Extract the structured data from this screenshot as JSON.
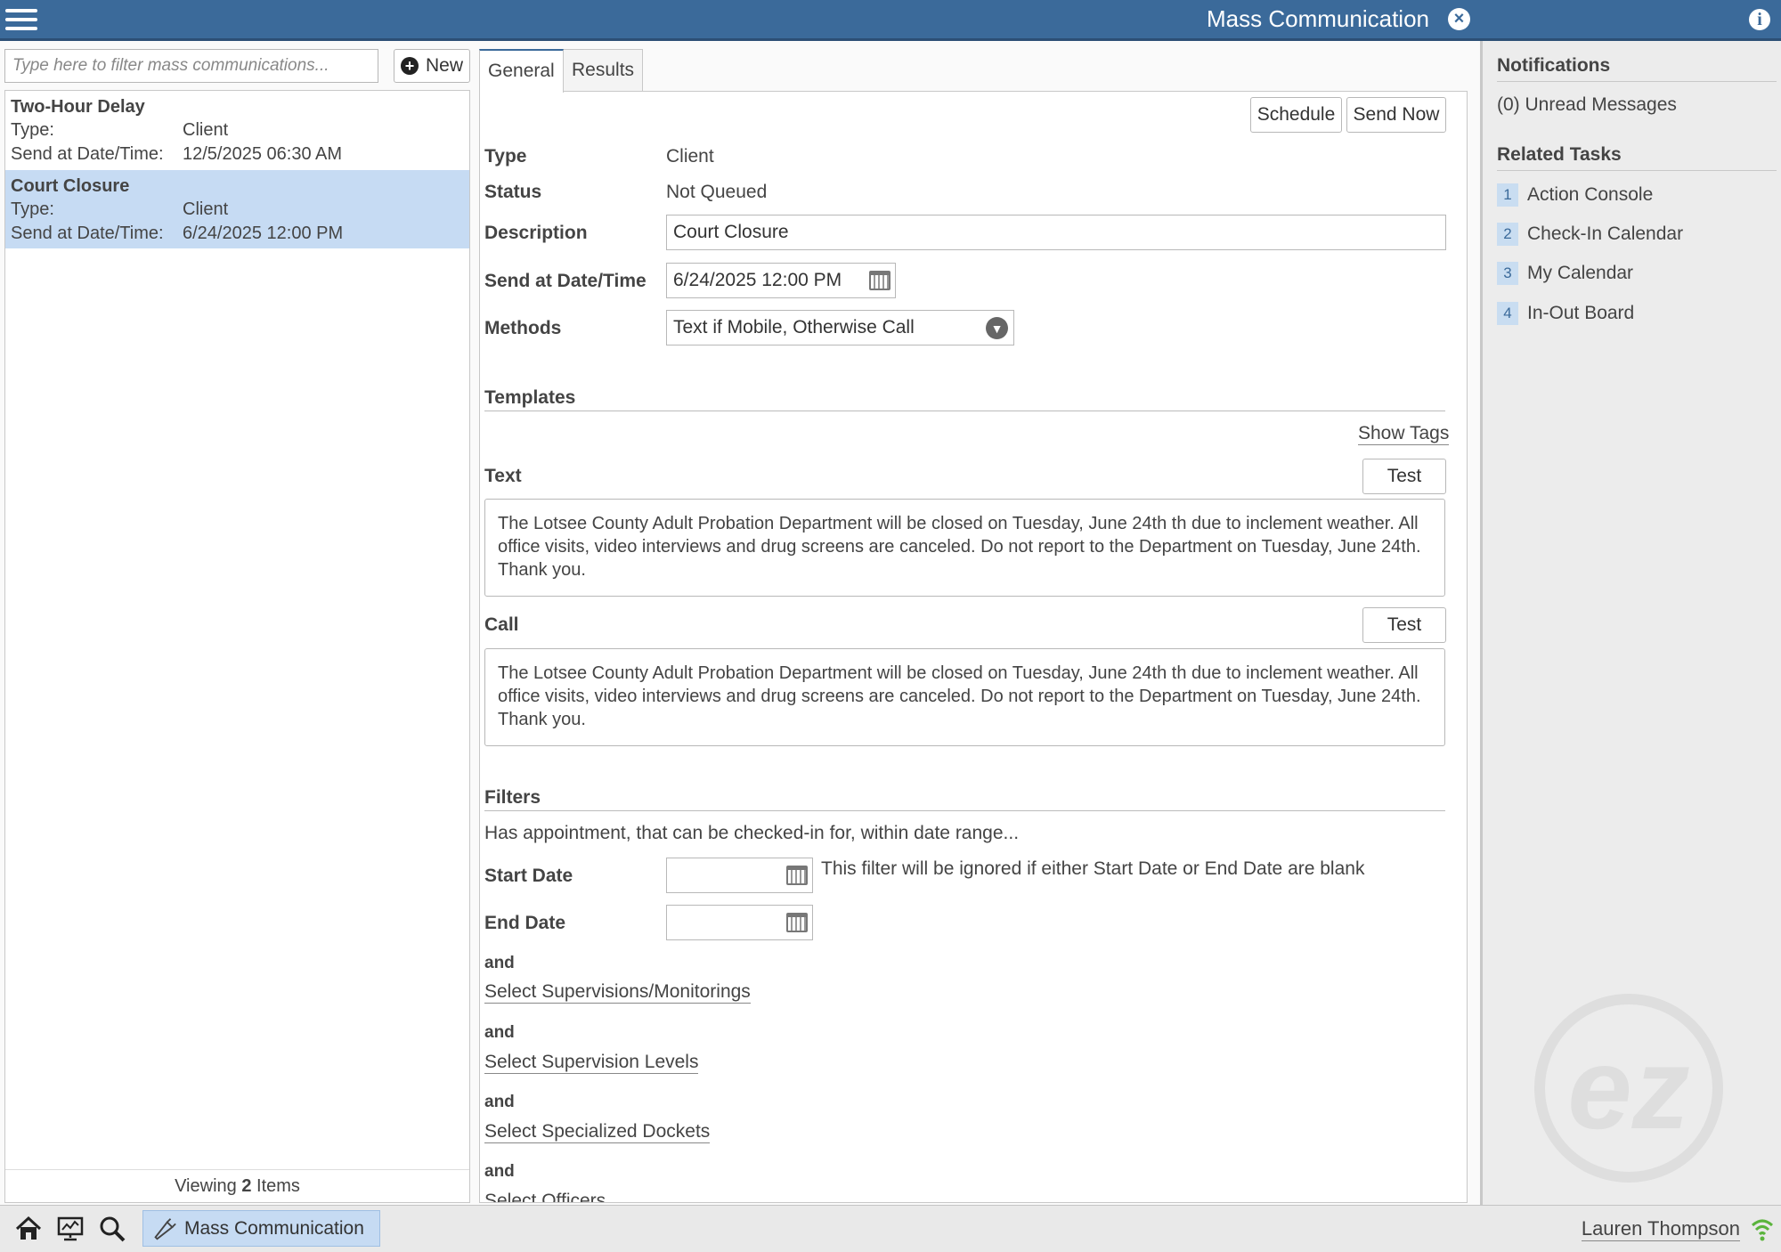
{
  "app": {
    "title": "Mass Communication"
  },
  "filter": {
    "placeholder": "Type here to filter mass communications...",
    "new_label": "New"
  },
  "list": {
    "items": [
      {
        "title": "Two-Hour Delay",
        "type_key": "Type:",
        "type_value": "Client",
        "send_key": "Send at Date/Time:",
        "send_value": "12/5/2025 06:30 AM",
        "selected": false
      },
      {
        "title": "Court Closure",
        "type_key": "Type:",
        "type_value": "Client",
        "send_key": "Send at Date/Time:",
        "send_value": "6/24/2025 12:00 PM",
        "selected": true
      }
    ],
    "footer_prefix": "Viewing",
    "footer_count": "2",
    "footer_suffix": "Items"
  },
  "tabs": [
    {
      "label": "General",
      "active": true
    },
    {
      "label": "Results",
      "active": false
    }
  ],
  "toolbar": {
    "schedule_label": "Schedule",
    "send_now_label": "Send Now"
  },
  "details": {
    "type_label": "Type",
    "type_value": "Client",
    "status_label": "Status",
    "status_value": "Not Queued",
    "description_label": "Description",
    "description_value": "Court Closure",
    "send_label": "Send at Date/Time",
    "send_value": "6/24/2025 12:00 PM",
    "methods_label": "Methods",
    "methods_value": "Text if Mobile, Otherwise Call"
  },
  "templates": {
    "heading": "Templates",
    "show_tags_label": "Show Tags",
    "text_label": "Text",
    "call_label": "Call",
    "test_label": "Test",
    "text_body": "The Lotsee County Adult Probation Department  will be closed on Tuesday, June 24th th due to inclement weather. All office visits, video interviews and drug screens are canceled. Do not report to the Department on Tuesday, June 24th. Thank you.",
    "call_body": "The Lotsee County Adult Probation Department  will be closed on Tuesday, June 24th th due to inclement weather. All office visits, video interviews and drug screens are canceled. Do not report to the Department on Tuesday, June 24th. Thank you."
  },
  "filters": {
    "heading": "Filters",
    "intro": "Has appointment, that can be checked-in for, within date range...",
    "start_label": "Start Date",
    "end_label": "End Date",
    "start_value": "",
    "end_value": "",
    "note": "This filter will be ignored if either Start Date or End Date are blank",
    "and_label": "and",
    "links": [
      "Select Supervisions/Monitorings",
      "Select Supervision Levels",
      "Select Specialized Dockets",
      "Select Officers"
    ]
  },
  "sidebar": {
    "notifications_heading": "Notifications",
    "unread": "(0) Unread Messages",
    "related_heading": "Related Tasks",
    "tasks": [
      {
        "num": "1",
        "label": "Action Console"
      },
      {
        "num": "2",
        "label": "Check-In Calendar"
      },
      {
        "num": "3",
        "label": "My Calendar"
      },
      {
        "num": "4",
        "label": "In-Out Board"
      }
    ],
    "watermark": "ez"
  },
  "taskbar": {
    "active_label": "Mass Communication",
    "user_name": "Lauren Thompson"
  },
  "colors": {
    "header": "#3b6a9a",
    "selected": "#c6dbf3",
    "accent": "#3b6a9a"
  }
}
